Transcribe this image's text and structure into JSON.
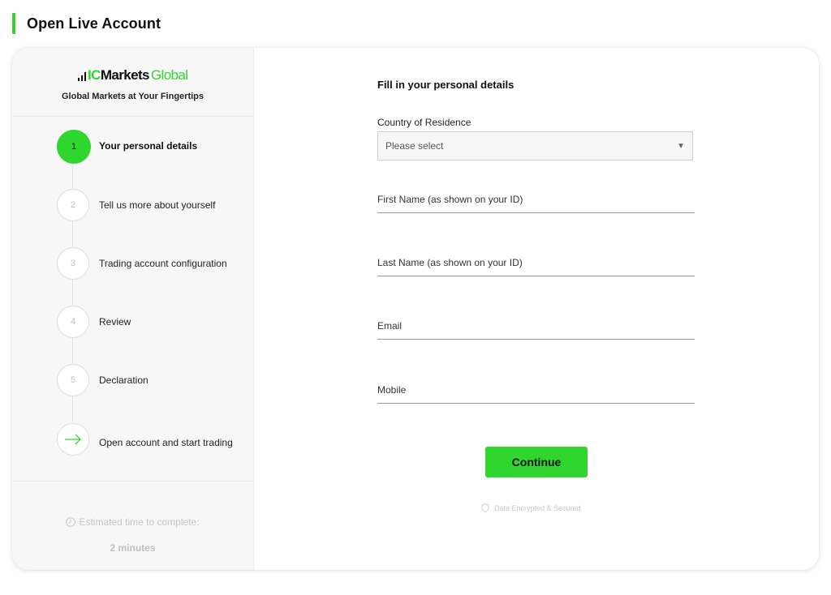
{
  "header": {
    "title": "Open Live Account",
    "accent_color": "#2ed62e"
  },
  "brand": {
    "logo_ic": "IC",
    "logo_markets": "Markets",
    "logo_global": "Global",
    "tagline": "Global Markets at Your Fingertips",
    "logo_icon": "bar-chart-icon"
  },
  "steps": [
    {
      "number": "1",
      "label": "Your personal details",
      "state": "active"
    },
    {
      "number": "2",
      "label": "Tell us more about yourself",
      "state": "pending"
    },
    {
      "number": "3",
      "label": "Trading account configuration",
      "state": "pending"
    },
    {
      "number": "4",
      "label": "Review",
      "state": "pending"
    },
    {
      "number": "5",
      "label": "Declaration",
      "state": "pending"
    },
    {
      "number": "",
      "icon": "arrow-right-icon",
      "label": "Open account and start trading",
      "state": "pending"
    }
  ],
  "estimate": {
    "label": "Estimated time to complete:",
    "time": "2 minutes",
    "icon": "clock-icon"
  },
  "form": {
    "heading": "Fill in your personal details",
    "country": {
      "label": "Country of Residence",
      "placeholder": "Please select"
    },
    "first_name": {
      "placeholder": "First Name (as shown on your ID)",
      "value": ""
    },
    "last_name": {
      "placeholder": "Last Name (as shown on your ID)",
      "value": ""
    },
    "email": {
      "placeholder": "Email",
      "value": ""
    },
    "mobile": {
      "placeholder": "Mobile",
      "value": ""
    },
    "continue_label": "Continue",
    "secure_note": "Data Encrypted & Secured",
    "secure_icon": "shield-icon"
  }
}
